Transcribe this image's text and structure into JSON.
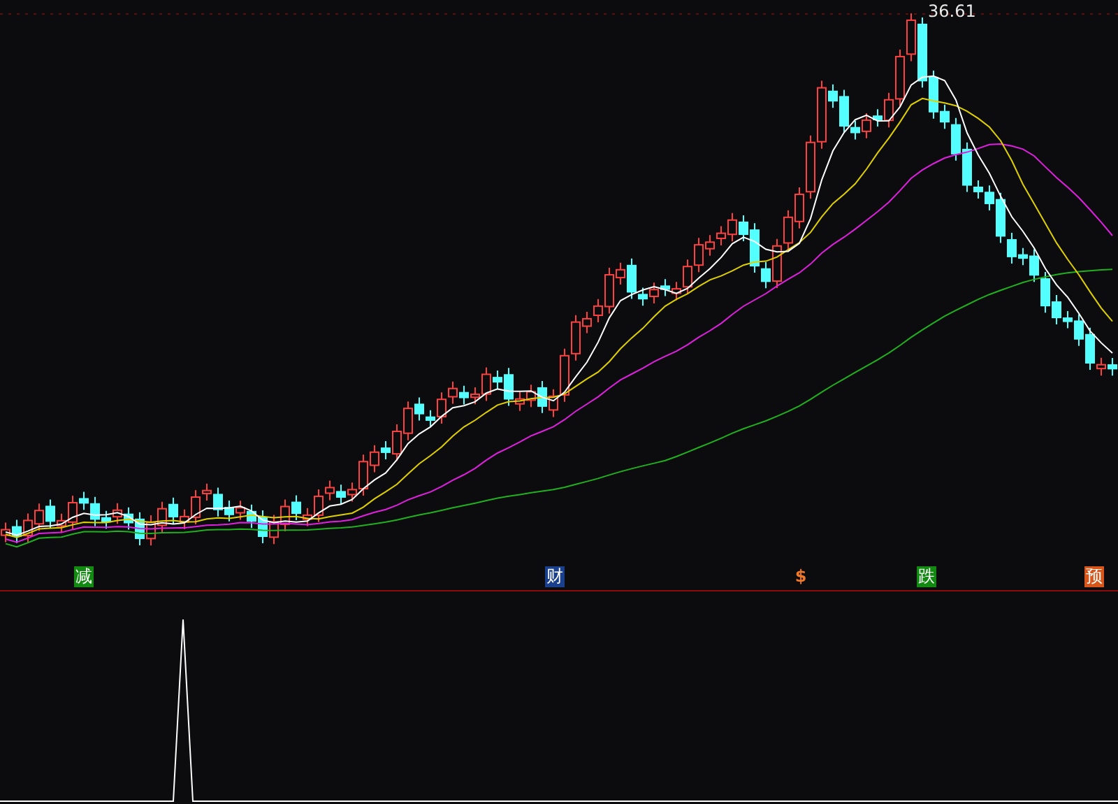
{
  "price_chart": {
    "high_label": "36.61",
    "event_markers": [
      {
        "label": "减",
        "kind": "badge",
        "color": "#128a12"
      },
      {
        "label": "财",
        "kind": "badge",
        "color": "#1a3f8c"
      },
      {
        "label": "$",
        "kind": "plain",
        "color": "#f07828"
      },
      {
        "label": "跌",
        "kind": "badge",
        "color": "#128a12"
      },
      {
        "label": "预",
        "kind": "badge",
        "color": "#d8561a"
      }
    ]
  }
}
